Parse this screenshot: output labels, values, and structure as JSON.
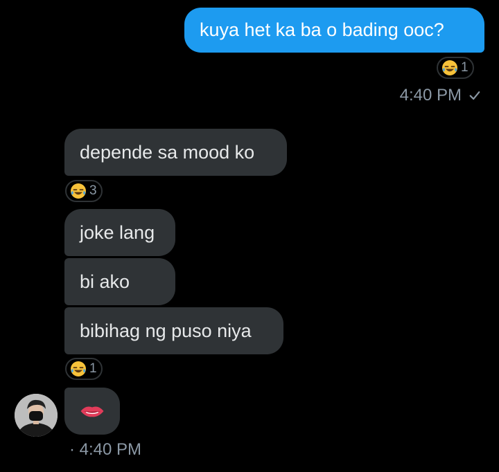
{
  "messages": {
    "outgoing_1": {
      "text": "kuya het ka ba o bading ooc?",
      "reaction_count": "1",
      "time": "4:40 PM"
    },
    "incoming_1": {
      "text": "depende sa mood ko",
      "reaction_count": "3"
    },
    "incoming_2": {
      "text": "joke lang"
    },
    "incoming_3": {
      "text": "bi ako"
    },
    "incoming_4": {
      "text": "bibihag ng puso niya",
      "reaction_count": "1"
    },
    "incoming_5": {
      "emoji": "👄"
    },
    "incoming_time": "· 4:40 PM"
  },
  "icons": {
    "reaction": "face-with-tears-of-joy-icon",
    "sent": "checkmark-icon",
    "lips": "lips-icon"
  },
  "colors": {
    "outgoing_bubble": "#1d9bf0",
    "incoming_bubble": "#2f3336",
    "secondary_text": "#8b98a5",
    "background": "#000000"
  }
}
